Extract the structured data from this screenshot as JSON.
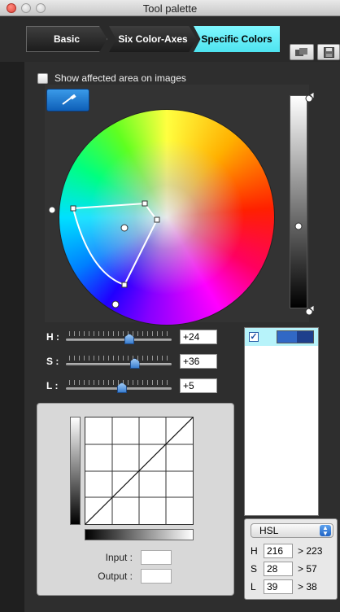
{
  "window": {
    "title": "Tool palette"
  },
  "tabs": [
    {
      "label": "Basic"
    },
    {
      "label": "Six Color-Axes"
    },
    {
      "label": "Specific Colors",
      "active": true
    }
  ],
  "toolbar": {
    "copy_icon": "copy-settings-icon",
    "save_icon": "save-icon"
  },
  "show_affected": {
    "label": "Show affected area on images",
    "checked": false
  },
  "eyedropper": {
    "icon": "eyedropper-icon"
  },
  "sliders": [
    {
      "label": "H :",
      "value": "+24",
      "level": 0.6
    },
    {
      "label": "S :",
      "value": "+36",
      "level": 0.65
    },
    {
      "label": "L :",
      "value": "+5",
      "level": 0.53
    }
  ],
  "curve": {
    "input_label": "Input :",
    "output_label": "Output :",
    "input_value": "",
    "output_value": ""
  },
  "color_list": [
    {
      "checked": true,
      "swatch_colors": [
        "#3168c5",
        "#1e3f8c"
      ]
    }
  ],
  "color_values": {
    "mode": "HSL",
    "rows": [
      {
        "label": "H",
        "input": "216",
        "output": "> 223"
      },
      {
        "label": "S",
        "input": "28",
        "output": "> 57"
      },
      {
        "label": "L",
        "input": "39",
        "output": "> 38"
      }
    ]
  },
  "colors": {
    "active_tab": "#6ef2fb",
    "selected_row": "#b7f3fa",
    "accent": "#1f63c4"
  }
}
